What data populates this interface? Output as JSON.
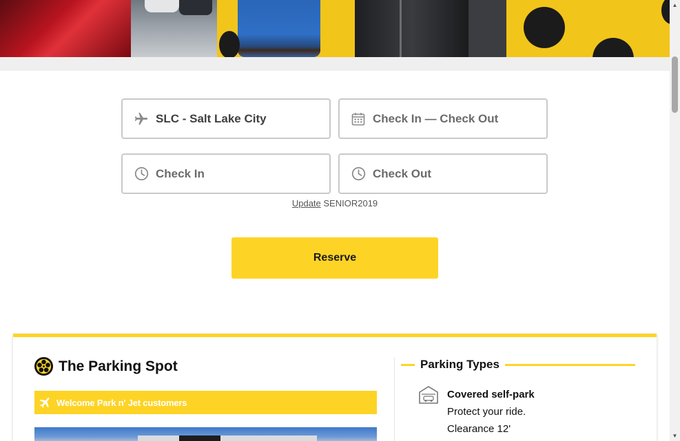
{
  "search": {
    "airport": "SLC - Salt Lake City",
    "dates_placeholder": "Check In — Check Out",
    "checkin_placeholder": "Check In",
    "checkout_placeholder": "Check Out",
    "update_link": "Update",
    "promo_code": "SENIOR2019",
    "reserve_label": "Reserve"
  },
  "lot": {
    "name": "The Parking Spot",
    "welcome_banner": "Welcome Park n' Jet customers"
  },
  "parking_types": {
    "title": "Parking Types",
    "items": [
      {
        "name": "Covered self-park",
        "lines": [
          "Protect your ride.",
          "Clearance 12'"
        ]
      }
    ]
  },
  "colors": {
    "accent": "#fdd425",
    "border": "#c9c9c9",
    "text_muted": "#6b6b6b"
  }
}
